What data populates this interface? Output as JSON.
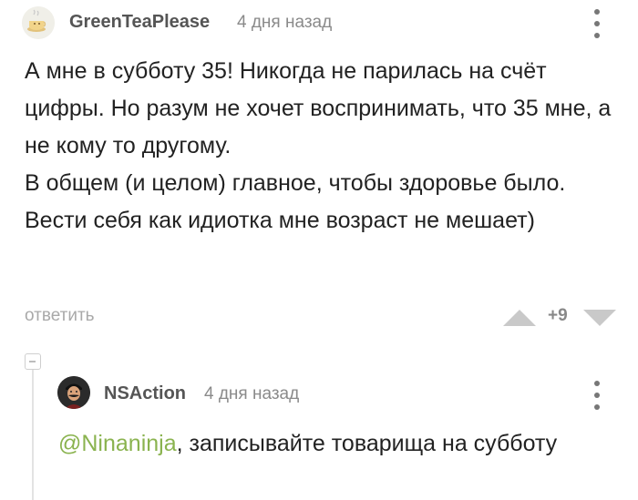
{
  "comment": {
    "author": "GreenTeaPlease",
    "time": "4 дня назад",
    "avatar_icon": "tea-cup-avatar",
    "text": "А мне в субботу 35! Никогда не парилась на счёт цифры. Но разум не хочет воспринимать, что 35 мне, а не кому то другому.\nВ общем (и целом) главное, чтобы здоровье было. Вести себя как идиотка мне возраст не мешает)",
    "reply_label": "ответить",
    "rating": "+9"
  },
  "reply": {
    "author": "NSAction",
    "time": "4 дня назад",
    "avatar_icon": "mustached-man-avatar",
    "mention": "@Ninaninja",
    "text": ", записывайте товарища на субботу"
  },
  "colors": {
    "text": "#222222",
    "meta": "#8a8a8a",
    "mention": "#8ab34f",
    "vote_arrow": "#c9c9c9"
  }
}
